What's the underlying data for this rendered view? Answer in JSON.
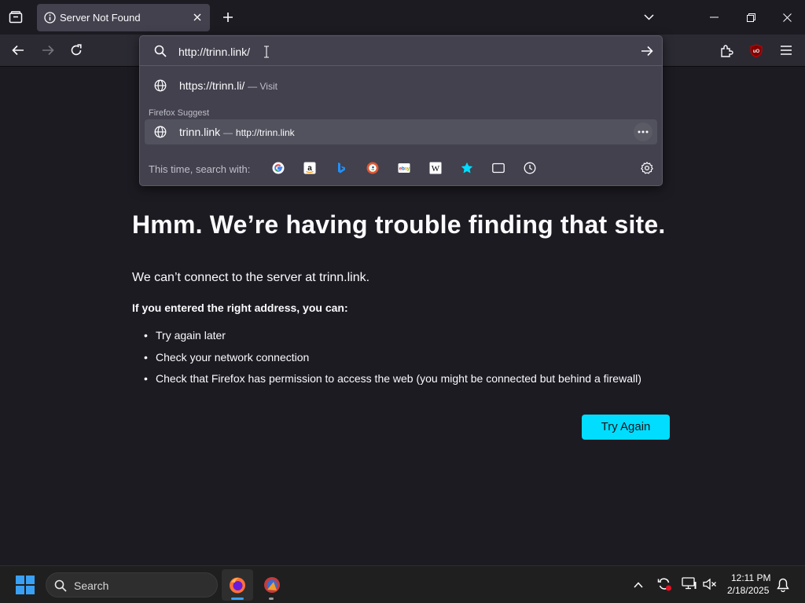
{
  "tab": {
    "title": "Server Not Found"
  },
  "urlbar": {
    "value": "http://trinn.link/",
    "results": [
      {
        "title": "https://trinn.li/",
        "sub": "— Visit"
      }
    ],
    "suggest_heading": "Firefox Suggest",
    "suggest": {
      "title": "trinn.link",
      "dash": "—",
      "url": "http://trinn.link"
    },
    "search_with_label": "This time, search with:",
    "engines": [
      "google-icon",
      "amazon-icon",
      "bing-icon",
      "duckduckgo-icon",
      "ebay-icon",
      "wikipedia-icon",
      "bookmarks-icon",
      "tabs-icon",
      "history-icon"
    ]
  },
  "error": {
    "title": "Hmm. We’re having trouble finding that site.",
    "description": "We can’t connect to the server at trinn.link.",
    "hint": "If you entered the right address, you can:",
    "bullets": [
      "Try again later",
      "Check your network connection",
      "Check that Firefox has permission to access the web (you might be connected but behind a firewall)"
    ],
    "button": "Try Again"
  },
  "taskbar": {
    "search_label": "Search",
    "time": "12:11 PM",
    "date": "2/18/2025"
  },
  "colors": {
    "accent": "#00ddff",
    "chrome": "#2b2a33",
    "popup": "#42414d",
    "page": "#1c1b22"
  }
}
